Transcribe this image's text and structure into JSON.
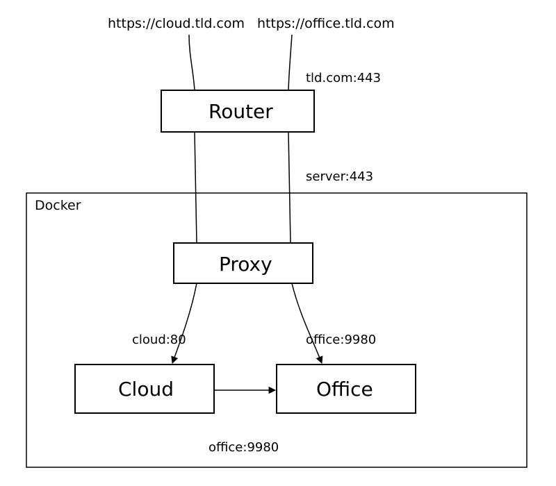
{
  "urls": {
    "cloud": "https://cloud.tld.com",
    "office": "https://office.tld.com"
  },
  "endpoints": {
    "router_in": "tld.com:443",
    "proxy_in": "server:443",
    "cloud_in": "cloud:80",
    "office_in": "office:9980",
    "cloud_to_office": "office:9980"
  },
  "containers": {
    "docker": "Docker"
  },
  "nodes": {
    "router": "Router",
    "proxy": "Proxy",
    "cloud": "Cloud",
    "office": "Office"
  }
}
